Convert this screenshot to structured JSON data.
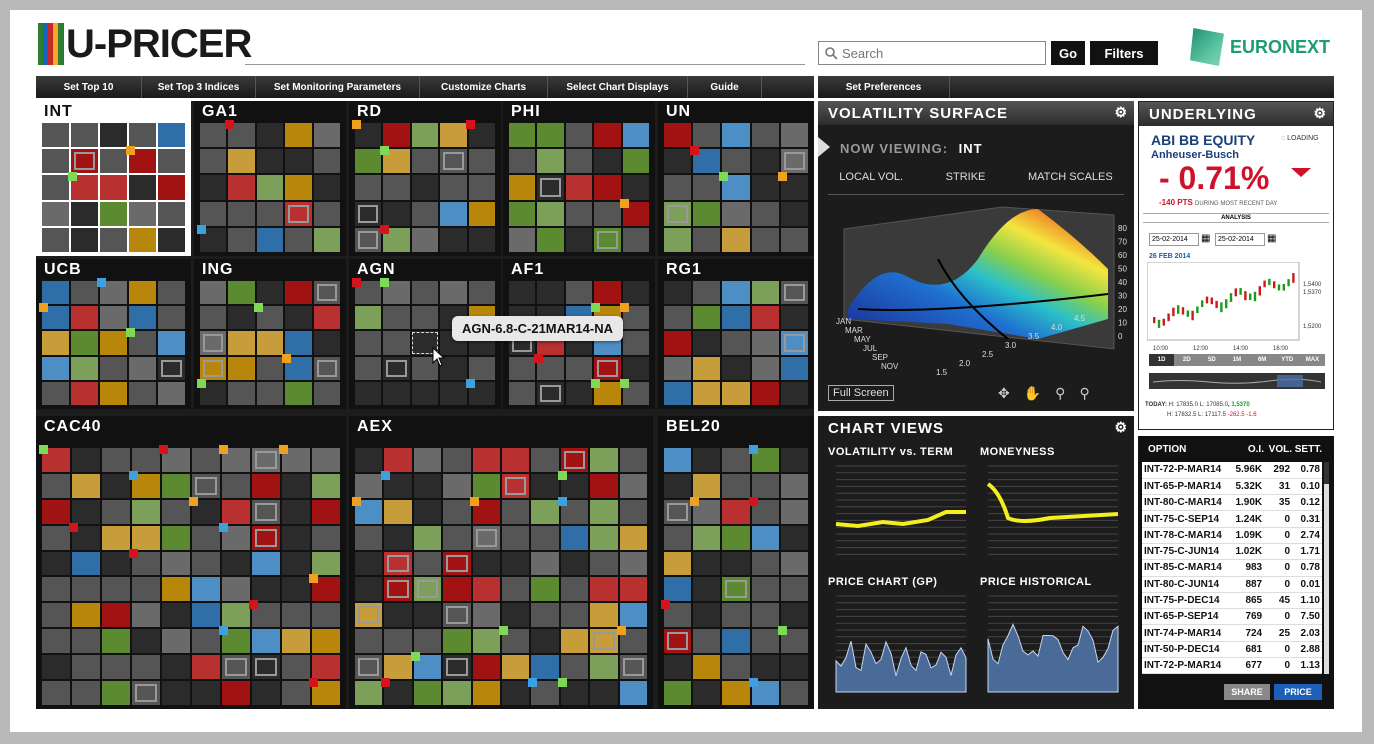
{
  "app": {
    "title": "U-PRICER",
    "brand": "EURONEXT"
  },
  "search": {
    "placeholder": "Search",
    "go": "Go",
    "filters": "Filters"
  },
  "menu": [
    "Set Top 10",
    "Set Top 3 Indices",
    "Set Monitoring Parameters",
    "Customize Charts",
    "Select Chart Displays",
    "Guide"
  ],
  "menu2": "Set Preferences",
  "sectors": [
    "INT",
    "GA1",
    "RD",
    "PHI",
    "UN",
    "UCB",
    "ING",
    "AGN",
    "AF1",
    "RG1",
    "CAC40",
    "AEX",
    "BEL20"
  ],
  "tooltip": "AGN-6.8-C-21MAR14-NA",
  "vol": {
    "title": "VOLATILITY SURFACE",
    "now_viewing_label": "NOW VIEWING:",
    "now_viewing": "INT",
    "tabs": [
      "LOCAL VOL.",
      "STRIKE",
      "MATCH SCALES"
    ],
    "full_screen": "Full Screen",
    "z_ticks": [
      "80",
      "70",
      "60",
      "50",
      "40",
      "30",
      "20",
      "10",
      "0"
    ],
    "months": [
      "JAN",
      "MAR",
      "MAY",
      "JUL",
      "SEP",
      "NOV"
    ],
    "strikes": [
      "1.5",
      "2.0",
      "2.5",
      "3.0",
      "3.5",
      "4.0",
      "4.5"
    ]
  },
  "charts": {
    "title": "CHART VIEWS",
    "items": [
      "VOLATILITY vs. TERM",
      "MONEYNESS",
      "PRICE CHART (GP)",
      "PRICE HISTORICAL"
    ]
  },
  "underlying": {
    "title": "UNDERLYING",
    "name": "ABI BB EQUITY",
    "company": "Anheuser-Busch",
    "loading": "LOADING",
    "change": "- 0.71%",
    "pts": "-140 PTS",
    "pts_note": "DURING MOST RECENT DAY",
    "analysis": "ANALYSIS",
    "date1": "25-02-2014",
    "date2": "25-02-2014",
    "chart_date": "26 FEB 2014",
    "y_ticks": [
      "1,5400",
      "1,5370",
      "1,5200"
    ],
    "x_ticks": [
      "10:00",
      "12:00",
      "14:00",
      "16:00"
    ],
    "ranges": [
      "1D",
      "2D",
      "5D",
      "1M",
      "6M",
      "YTD",
      "MAX"
    ],
    "today_label": "TODAY:",
    "today1": "H: 17835.0 L: 17085.0",
    "today1b": "1,5370",
    "today2": "H: 17832.5 L: 17117.5",
    "today2b": "-262.5",
    "today2c": "-1.6"
  },
  "options": {
    "headers": [
      "OPTION",
      "O.I.",
      "VOL.",
      "SETT."
    ],
    "rows": [
      [
        "INT-72-P-MAR14",
        "5.96K",
        "292",
        "0.78"
      ],
      [
        "INT-65-P-MAR14",
        "5.32K",
        "31",
        "0.10"
      ],
      [
        "INT-80-C-MAR14",
        "1.90K",
        "35",
        "0.12"
      ],
      [
        "INT-75-C-SEP14",
        "1.24K",
        "0",
        "0.31"
      ],
      [
        "INT-78-C-MAR14",
        "1.09K",
        "0",
        "2.74"
      ],
      [
        "INT-75-C-JUN14",
        "1.02K",
        "0",
        "1.71"
      ],
      [
        "INT-85-C-MAR14",
        "983",
        "0",
        "0.78"
      ],
      [
        "INT-80-C-JUN14",
        "887",
        "0",
        "0.01"
      ],
      [
        "INT-75-P-DEC14",
        "865",
        "45",
        "1.10"
      ],
      [
        "INT-65-P-SEP14",
        "769",
        "0",
        "7.50"
      ],
      [
        "INT-74-P-MAR14",
        "724",
        "25",
        "2.03"
      ],
      [
        "INT-50-P-DEC14",
        "681",
        "0",
        "2.88"
      ],
      [
        "INT-72-P-MAR14",
        "677",
        "0",
        "1.13"
      ]
    ],
    "share": "SHARE",
    "price": "PRICE"
  },
  "colors": {
    "accent_red": "#d0112b",
    "green": "#5b8a30",
    "blue": "#2f6ea6",
    "amber": "#b8860b",
    "red": "#a11212",
    "bg": "#1c1c1c"
  }
}
